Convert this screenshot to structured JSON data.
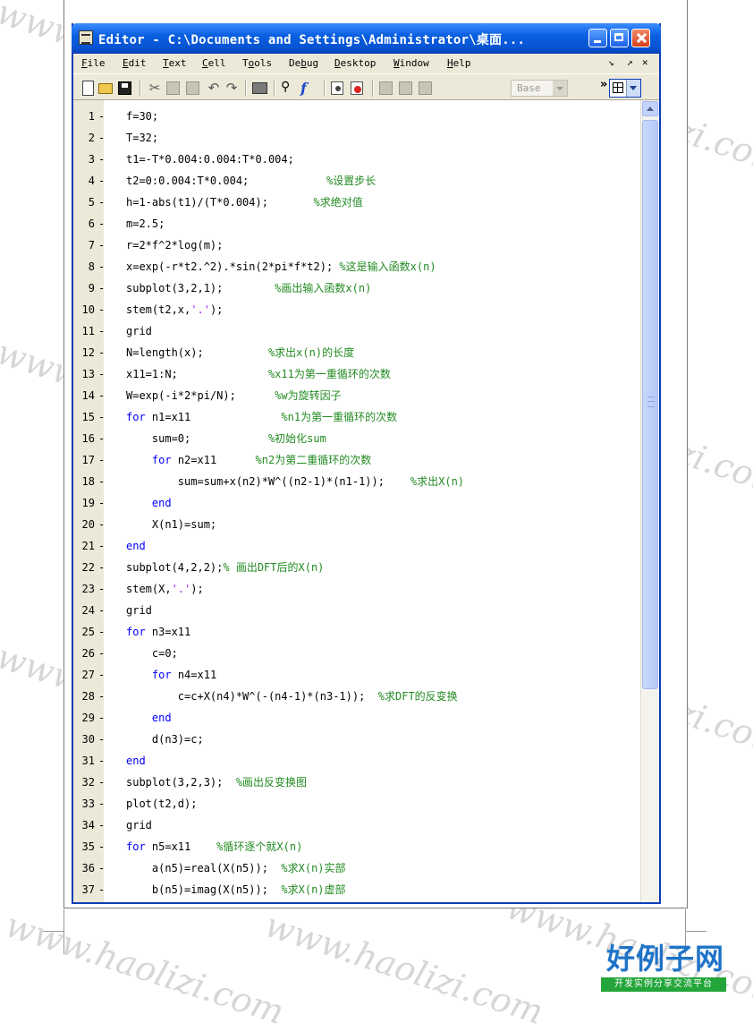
{
  "window": {
    "title": "Editor - C:\\Documents and Settings\\Administrator\\桌面..."
  },
  "menubar": {
    "items": [
      "File",
      "Edit",
      "Text",
      "Cell",
      "Tools",
      "Debug",
      "Desktop",
      "Window",
      "Help"
    ],
    "underline": [
      "F",
      "E",
      "T",
      "C",
      "o",
      "b",
      "D",
      "W",
      "H"
    ],
    "mini_controls": [
      "↘",
      "↗",
      "✕"
    ]
  },
  "toolbar": {
    "base_label": "Base",
    "icons": [
      "new-file-icon",
      "open-folder-icon",
      "save-icon",
      "cut-icon",
      "copy-icon",
      "paste-icon",
      "undo-icon",
      "redo-icon",
      "print-icon",
      "find-icon",
      "function-icon",
      "set-breakpoint-icon",
      "clear-breakpoint-icon",
      "step-icon",
      "step-in-icon",
      "step-out-icon"
    ]
  },
  "code": {
    "lines": [
      [
        {
          "t": "f=30;"
        }
      ],
      [
        {
          "t": "T=32;"
        }
      ],
      [
        {
          "t": "t1=-T*0.004:0.004:T*0.004;"
        }
      ],
      [
        {
          "t": "t2=0:0.004:T*0.004;            "
        },
        {
          "c": "cm",
          "t": "%设置步长"
        }
      ],
      [
        {
          "t": "h=1-abs(t1)/(T*0.004);       "
        },
        {
          "c": "cm",
          "t": "%求绝对值"
        }
      ],
      [
        {
          "t": "m=2.5;"
        }
      ],
      [
        {
          "t": "r=2*f^2*log(m);"
        }
      ],
      [
        {
          "t": "x=exp(-r*t2.^2).*sin(2*pi*f*t2); "
        },
        {
          "c": "cm",
          "t": "%这是输入函数x(n)"
        }
      ],
      [
        {
          "t": "subplot(3,2,1);        "
        },
        {
          "c": "cm",
          "t": "%画出输入函数x(n)"
        }
      ],
      [
        {
          "t": "stem(t2,x,"
        },
        {
          "c": "st",
          "t": "'.'"
        },
        {
          "t": ");"
        }
      ],
      [
        {
          "t": "grid"
        }
      ],
      [
        {
          "t": "N=length(x);          "
        },
        {
          "c": "cm",
          "t": "%求出x(n)的长度"
        }
      ],
      [
        {
          "t": "x11=1:N;              "
        },
        {
          "c": "cm",
          "t": "%x11为第一重循环的次数"
        }
      ],
      [
        {
          "t": "W=exp(-i*2*pi/N);      "
        },
        {
          "c": "cm",
          "t": "%w为旋转因子"
        }
      ],
      [
        {
          "c": "kw",
          "t": "for"
        },
        {
          "t": " n1=x11              "
        },
        {
          "c": "cm",
          "t": "%n1为第一重循环的次数"
        }
      ],
      [
        {
          "t": "    sum=0;            "
        },
        {
          "c": "cm",
          "t": "%初始化sum"
        }
      ],
      [
        {
          "t": "    "
        },
        {
          "c": "kw",
          "t": "for"
        },
        {
          "t": " n2=x11      "
        },
        {
          "c": "cm",
          "t": "%n2为第二重循环的次数"
        }
      ],
      [
        {
          "t": "        sum=sum+x(n2)*W^((n2-1)*(n1-1));    "
        },
        {
          "c": "cm",
          "t": "%求出X(n)"
        }
      ],
      [
        {
          "t": "    "
        },
        {
          "c": "kw",
          "t": "end"
        }
      ],
      [
        {
          "t": "    X(n1)=sum;"
        }
      ],
      [
        {
          "c": "kw",
          "t": "end"
        }
      ],
      [
        {
          "t": "subplot(4,2,2);"
        },
        {
          "c": "cm",
          "t": "% 画出DFT后的X(n)"
        }
      ],
      [
        {
          "t": "stem(X,"
        },
        {
          "c": "st",
          "t": "'.'"
        },
        {
          "t": ");"
        }
      ],
      [
        {
          "t": "grid"
        }
      ],
      [
        {
          "c": "kw",
          "t": "for"
        },
        {
          "t": " n3=x11"
        }
      ],
      [
        {
          "t": "    c=0;"
        }
      ],
      [
        {
          "t": "    "
        },
        {
          "c": "kw",
          "t": "for"
        },
        {
          "t": " n4=x11"
        }
      ],
      [
        {
          "t": "        c=c+X(n4)*W^(-(n4-1)*(n3-1));  "
        },
        {
          "c": "cm",
          "t": "%求DFT的反变换"
        }
      ],
      [
        {
          "t": "    "
        },
        {
          "c": "kw",
          "t": "end"
        }
      ],
      [
        {
          "t": "    d(n3)=c;"
        }
      ],
      [
        {
          "c": "kw",
          "t": "end"
        }
      ],
      [
        {
          "t": "subplot(3,2,3);  "
        },
        {
          "c": "cm",
          "t": "%画出反变换图"
        }
      ],
      [
        {
          "t": "plot(t2,d);"
        }
      ],
      [
        {
          "t": "grid"
        }
      ],
      [
        {
          "c": "kw",
          "t": "for"
        },
        {
          "t": " n5=x11    "
        },
        {
          "c": "cm",
          "t": "%循环逐个就X(n)"
        }
      ],
      [
        {
          "t": "    a(n5)=real(X(n5));  "
        },
        {
          "c": "cm",
          "t": "%求X(n)实部"
        }
      ],
      [
        {
          "t": "    b(n5)=imag(X(n5));  "
        },
        {
          "c": "cm",
          "t": "%求X(n)虚部"
        }
      ]
    ],
    "line_marker": "-"
  },
  "colors": {
    "keyword": "#0000ff",
    "comment": "#228b22",
    "string": "#a020f0",
    "titlebar": "#0a5fe0"
  },
  "watermark": "www.haolizi.com",
  "logo": {
    "title": "好例子网",
    "subtitle": "开发实例分享交流平台"
  }
}
